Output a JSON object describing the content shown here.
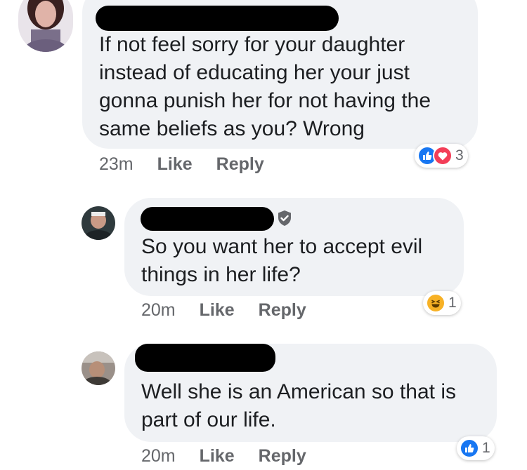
{
  "comments": [
    {
      "text_lines": [
        "If not feel sorry for your daughter",
        "instead of educating her your just",
        "gonna punish her for not having the",
        "same beliefs as you? Wrong"
      ],
      "time": "23m",
      "like_label": "Like",
      "reply_label": "Reply",
      "reactions": {
        "icons": [
          "like-icon",
          "love-icon"
        ],
        "count": "3"
      }
    },
    {
      "text_lines": [
        "So you want her to accept evil",
        "things in her life?"
      ],
      "time": "20m",
      "like_label": "Like",
      "reply_label": "Reply",
      "reactions": {
        "icons": [
          "haha-icon"
        ],
        "count": "1"
      }
    },
    {
      "text_lines": [
        "Well she is an American so that is",
        "part of our life."
      ],
      "time": "20m",
      "like_label": "Like",
      "reply_label": "Reply",
      "reactions": {
        "icons": [
          "like-icon"
        ],
        "count": "1"
      }
    }
  ],
  "colors": {
    "bubble": "#f0f2f5",
    "meta": "#65676b",
    "like": "#1877f2",
    "love": "#f33e58",
    "haha": "#f7b125"
  }
}
